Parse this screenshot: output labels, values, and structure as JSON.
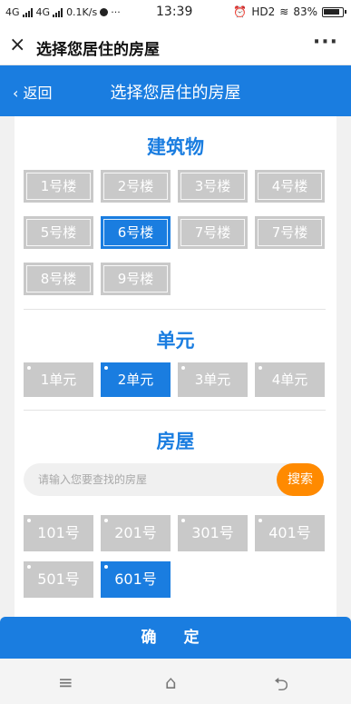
{
  "status": {
    "network": "4G",
    "network2": "4G",
    "speed": "0.1K/s",
    "dots": "···",
    "time": "13:39",
    "hd": "HD2",
    "battery": "83%"
  },
  "titlebar": {
    "close_icon": "×",
    "title": "选择您居住的房屋",
    "more_icon": "···"
  },
  "navbar": {
    "back": "‹ 返回",
    "title": "选择您居住的房屋"
  },
  "buildings": {
    "title": "建筑物",
    "items": [
      "1号楼",
      "2号楼",
      "3号楼",
      "4号楼",
      "5号楼",
      "6号楼",
      "7号楼",
      "7号楼",
      "8号楼",
      "9号楼"
    ],
    "selected_index": 5
  },
  "units": {
    "title": "单元",
    "items": [
      "1单元",
      "2单元",
      "3单元",
      "4单元"
    ],
    "selected_index": 1
  },
  "rooms": {
    "title": "房屋",
    "search_placeholder": "请输入您要查找的房屋",
    "search_button": "搜索",
    "items": [
      "101号",
      "201号",
      "301号",
      "401号",
      "501号",
      "601号"
    ],
    "selected_index": 5
  },
  "confirm": "确 定",
  "sysnav": {
    "menu_icon": "≡",
    "home_icon": "⌂",
    "back_icon": "⮌"
  },
  "colors": {
    "accent": "#1a7de0",
    "search_button": "#ff8a00",
    "tile": "#c9c9c9"
  }
}
